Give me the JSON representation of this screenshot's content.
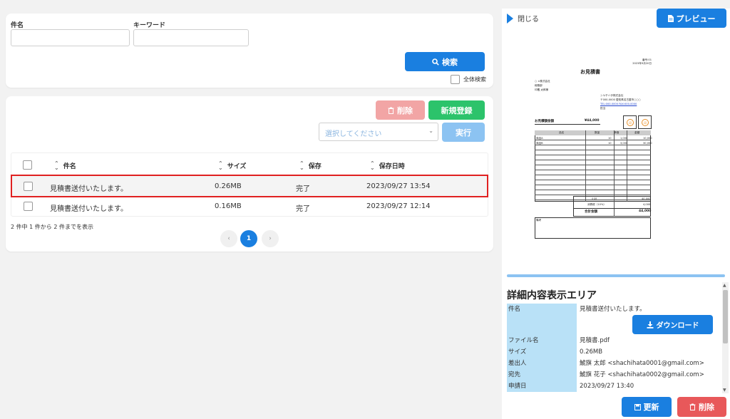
{
  "search": {
    "subject_label": "件名",
    "keyword_label": "キーワード",
    "search_button": "検索",
    "all_search_label": "全体検索"
  },
  "list": {
    "delete_button": "削除",
    "new_button": "新規登録",
    "select_placeholder": "選択してください",
    "execute_button": "実行",
    "headers": {
      "subject": "件名",
      "size": "サイズ",
      "status": "保存",
      "datetime": "保存日時"
    },
    "rows": [
      {
        "subject": "見積書送付いたします。",
        "size": "0.26MB",
        "status": "完了",
        "datetime": "2023/09/27 13:54"
      },
      {
        "subject": "見積書送付いたします。",
        "size": "0.16MB",
        "status": "完了",
        "datetime": "2023/09/27 12:14"
      }
    ],
    "summary": "2 件中 1 件から 2 件までを表示",
    "pagination": {
      "prev": "‹",
      "current": "1",
      "next": "›"
    }
  },
  "panel": {
    "close_label": "閉じる",
    "preview_button": "プレビュー",
    "doc": {
      "number": "番号:01",
      "date": "2023年9月20日",
      "title": "お見積書",
      "client": "○ ×株式会社",
      "dept": "総務部",
      "attention": "印鑑 太郎様",
      "company": "シヤチハタ株式会社",
      "address": "〒000-0000 愛知県名古屋市○○○",
      "contact": "TEL:000-0000 FAX:000-0000",
      "rep": "担当",
      "total_label": "お見積額金額",
      "total_value": "¥44,000",
      "seal": "印",
      "col_item": "品名",
      "col_qty": "数量",
      "col_price": "単価",
      "col_amount": "金額",
      "line1": "商品A",
      "line1_qty": "10",
      "line1_price": "1,000",
      "line1_amount": "10,000",
      "line2": "商品B",
      "line2_qty": "10",
      "line2_price": "3,000",
      "line2_amount": "30,000",
      "subtotal_label": "小計",
      "subtotal": "40,000",
      "tax_label": "消費税（10%）",
      "tax": "4,000",
      "grand_label": "合計金額",
      "grand": "44,000",
      "remarks": "備考"
    },
    "detail_title": "詳細内容表示エリア",
    "download_button": "ダウンロード",
    "details": [
      {
        "key": "件名",
        "value": "見積書送付いたします。"
      },
      {
        "key": "ファイル名",
        "value": "見積書.pdf"
      },
      {
        "key": "サイズ",
        "value": "0.26MB"
      },
      {
        "key": "差出人",
        "value": "鯱旗 太郎 <shachihata0001@gmail.com>"
      },
      {
        "key": "宛先",
        "value": "鯱旗 花子 <shachihata0002@gmail.com>"
      },
      {
        "key": "申請日",
        "value": "2023/09/27 13:40"
      }
    ],
    "update_button": "更新",
    "delete_button": "削除"
  },
  "colors": {
    "primary": "#1a7fe0",
    "success": "#2cc36b",
    "danger_light": "#f2a5a5",
    "primary_light": "#8cc3f2",
    "danger": "#e8585a",
    "highlight": "#e02020"
  }
}
